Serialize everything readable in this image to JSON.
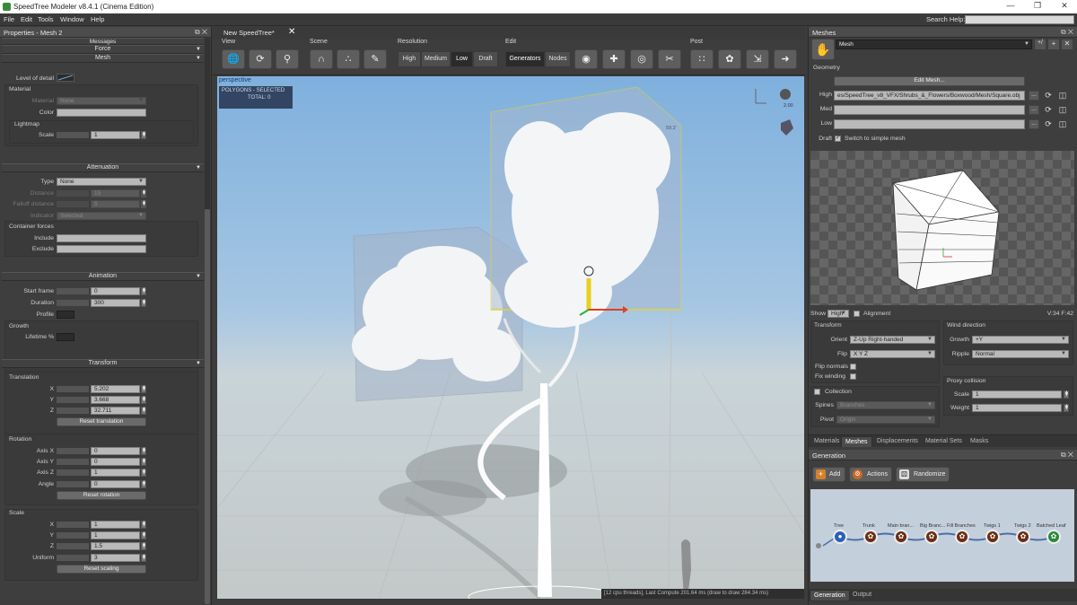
{
  "titlebar": {
    "title": "SpeedTree Modeler v8.4.1 (Cinema Edition)"
  },
  "menu": {
    "items": [
      "File",
      "Edit",
      "Tools",
      "Window",
      "Help"
    ],
    "search_label": "Search Help:"
  },
  "left": {
    "title": "Properties - Mesh 2",
    "messages": "Messages",
    "force": "Force",
    "mesh": "Mesh",
    "lod_label": "Level of detail",
    "material": {
      "header": "Material",
      "material_label": "Material",
      "material_value": "None",
      "color_label": "Color",
      "lightmap_label": "Lightmap",
      "scale_label": "Scale",
      "scale_value": "1"
    },
    "attenuation": {
      "title": "Attenuation",
      "type_label": "Type",
      "type_value": "None",
      "distance_label": "Distance",
      "distance_value": "15",
      "falloff_label": "Falloff distance",
      "falloff_value": "5",
      "indicator_label": "Indicator",
      "indicator_value": "Selected",
      "container_label": "Container forces",
      "include_label": "Include",
      "exclude_label": "Exclude"
    },
    "animation": {
      "title": "Animation",
      "start_label": "Start frame",
      "start_value": "0",
      "duration_label": "Duration",
      "duration_value": "300",
      "profile_label": "Profile",
      "growth_label": "Growth",
      "lifetime_label": "Lifetime %"
    },
    "transform": {
      "title": "Transform",
      "translation": "Translation",
      "x": "X",
      "y": "Y",
      "z": "Z",
      "tx": "5.202",
      "ty": "3.668",
      "tz": "32.711",
      "reset_translation": "Reset translation",
      "rotation": "Rotation",
      "axis_x": "Axis X",
      "axis_y": "Axis Y",
      "axis_z": "Axis Z",
      "angle": "Angle",
      "ax": "0",
      "ay": "0",
      "az": "1",
      "angle_value": "0",
      "reset_rotation": "Reset rotation",
      "scale": "Scale",
      "sx": "1",
      "sy": "1",
      "sz": "1.5",
      "uniform_label": "Uniform",
      "uniform_value": "3",
      "reset_scaling": "Reset scaling"
    }
  },
  "doc_tab": {
    "label": "New SpeedTree*"
  },
  "toolbar": {
    "view": "View",
    "scene": "Scene",
    "resolution": "Resolution",
    "res_high": "High",
    "res_medium": "Medium",
    "res_low": "Low",
    "res_draft": "Draft",
    "edit": "Edit",
    "generators": "Generators",
    "nodes": "Nodes",
    "post": "Post"
  },
  "viewport": {
    "perspective": "perspective",
    "polygons": "POLYGONS - SELECTED",
    "total": "TOTAL: 0",
    "status": "[12 cpu threads], Last Compute 201.64 ms (draw to draw 284.34 ms)",
    "zoom": "2.00",
    "dim": "59.2'"
  },
  "meshes": {
    "title": "Meshes",
    "mesh_value": "Mesh",
    "geometry": "Geometry",
    "edit_mesh": "Edit Mesh...",
    "high_label": "High",
    "high_value": "es/SpeedTree_v8_VFX/Shrubs_&_Flowers/Boxwood/Mesh/Square.obj",
    "med_label": "Med",
    "low_label": "Low",
    "draft_label": "Draft",
    "switch_label": "Switch to simple mesh",
    "show_label": "Show",
    "show_value": "High",
    "alignment_label": "Alignment",
    "stats": "V:34 F:42",
    "transform": "Transform",
    "orient_label": "Orient",
    "orient_value": "Z-Up Right-handed",
    "flip_label": "Flip",
    "flip_value": "X Y Z",
    "flip_normals": "Flip normals",
    "fix_winding": "Fix winding",
    "wind": "Wind direction",
    "growth_label": "Growth",
    "growth_value": "+Y",
    "ripple_label": "Ripple",
    "ripple_value": "Normal",
    "proxy": "Proxy collision",
    "scale_label": "Scale",
    "scale_value": "1",
    "weight_label": "Weight",
    "weight_value": "1",
    "collection": "Collection",
    "spines_label": "Spines",
    "spines_value": "Branches",
    "pivot_label": "Pivot",
    "pivot_value": "Origin",
    "tabs": [
      "Materials",
      "Meshes",
      "Displacements",
      "Material Sets",
      "Masks"
    ]
  },
  "generation": {
    "title": "Generation",
    "add": "Add",
    "actions": "Actions",
    "randomize": "Randomize",
    "nodes": [
      "Tree",
      "Trunk",
      "Main bran...",
      "Big Branc...",
      "Fill Branches",
      "Twigs 1",
      "Twigs 2",
      "Batched Leaf"
    ],
    "tabs": [
      "Generation",
      "Output"
    ]
  },
  "colors": {
    "accent": "#6a9fd8",
    "sky": "#8ab5de",
    "bbox_sel": "#e0d040"
  }
}
